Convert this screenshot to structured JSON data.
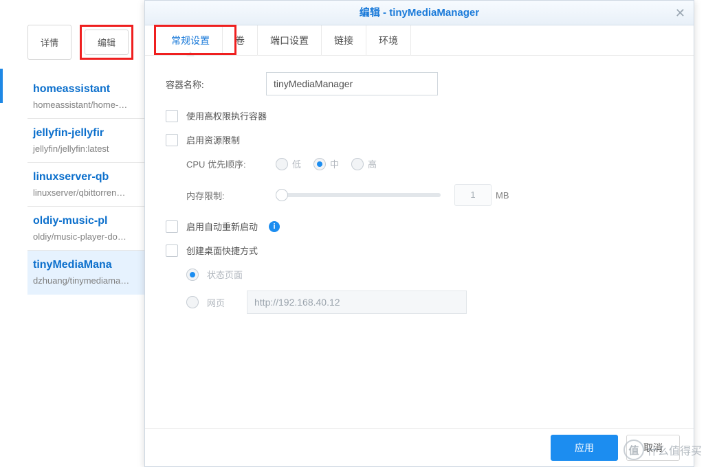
{
  "top_buttons": {
    "details": "详情",
    "edit": "编辑"
  },
  "containers": [
    {
      "name": "homeassistant",
      "sub": "homeassistant/home-…",
      "selected": false
    },
    {
      "name": "jellyfin-jellyfir",
      "sub": "jellyfin/jellyfin:latest",
      "selected": false
    },
    {
      "name": "linuxserver-qb",
      "sub": "linuxserver/qbittorren…",
      "selected": false
    },
    {
      "name": "oldiy-music-pl",
      "sub": "oldiy/music-player-do…",
      "selected": false
    },
    {
      "name": "tinyMediaMana",
      "sub": "dzhuang/tinymediama…",
      "selected": true
    }
  ],
  "modal": {
    "title": "编辑 - tinyMediaManager",
    "tabs": {
      "general": "常规设置",
      "volume": "卷",
      "port": "端口设置",
      "link": "链接",
      "env": "环境"
    },
    "fields": {
      "container_name_label": "容器名称:",
      "container_name_value": "tinyMediaManager",
      "exec_privileged": "使用高权限执行容器",
      "enable_resource_limit": "启用资源限制",
      "cpu_priority_label": "CPU 优先顺序:",
      "cpu_low": "低",
      "cpu_mid": "中",
      "cpu_high": "高",
      "memory_limit_label": "内存限制:",
      "memory_value": "1",
      "memory_unit": "MB",
      "enable_auto_restart": "启用自动重新启动",
      "create_shortcut": "创建桌面快捷方式",
      "shortcut_status": "状态页面",
      "shortcut_web": "网页",
      "shortcut_url": "http://192.168.40.12"
    },
    "footer": {
      "apply": "应用",
      "cancel": "取消"
    }
  },
  "watermark": {
    "logo": "值",
    "text": "什么值得买"
  }
}
